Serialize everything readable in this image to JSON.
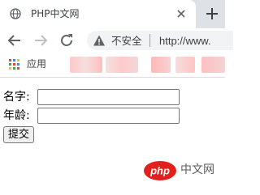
{
  "browser": {
    "tab": {
      "title": "PHP中文网",
      "favicon": "globe-icon",
      "close_icon": "close-icon"
    },
    "new_tab_icon": "plus-icon",
    "toolbar": {
      "back_icon": "arrow-left-icon",
      "forward_icon": "arrow-right-icon",
      "reload_icon": "reload-icon",
      "security_icon": "warning-triangle-icon",
      "security_label": "不安全",
      "url": "http://www."
    },
    "bookmarks_bar": {
      "apps_icon": "apps-grid-icon",
      "apps_label": "应用"
    }
  },
  "form": {
    "name_label": "名字:",
    "name_value": "",
    "age_label": "年龄:",
    "age_value": "",
    "submit_label": "提交"
  },
  "watermark": {
    "logo_text": "php",
    "site_text": "中文网"
  },
  "colors": {
    "tabstrip_bg": "#dee1e6",
    "omnibox_bg": "#f1f3f4",
    "icon_gray": "#5f6368",
    "watermark_red": "#e2211c"
  }
}
